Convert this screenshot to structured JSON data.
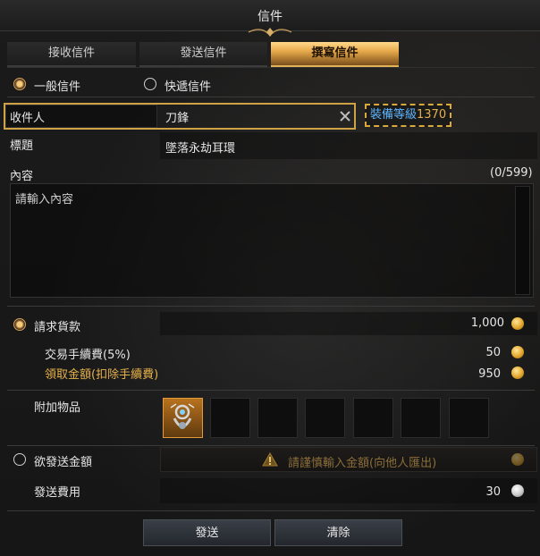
{
  "window": {
    "title": "信件"
  },
  "tabs": [
    {
      "label": "接收信件",
      "active": false
    },
    {
      "label": "發送信件",
      "active": false
    },
    {
      "label": "撰寫信件",
      "active": true
    }
  ],
  "mail_type": {
    "options": [
      {
        "label": "一般信件",
        "selected": true
      },
      {
        "label": "快遞信件",
        "selected": false
      }
    ]
  },
  "recipient": {
    "label": "收件人",
    "value": "刀鋒",
    "clear_icon": "close-icon",
    "gear_level_label": "裝備等級",
    "gear_level_value": "1370"
  },
  "subject": {
    "label": "標題",
    "value": "墜落永劫耳環"
  },
  "content": {
    "label": "內容",
    "counter": "(0/599)",
    "placeholder": "請輸入內容"
  },
  "payment_request": {
    "label": "請求貨款",
    "selected": true,
    "amount": "1,000",
    "fee_label": "交易手續費(5%)",
    "fee_value": "50",
    "receive_label": "領取金額(扣除手續費)",
    "receive_value": "950",
    "coin_icon": "gold-coin-icon"
  },
  "attachments": {
    "label": "附加物品",
    "slots": [
      {
        "item": "earring-item-icon"
      },
      {
        "item": ""
      },
      {
        "item": ""
      },
      {
        "item": ""
      },
      {
        "item": ""
      },
      {
        "item": ""
      },
      {
        "item": ""
      }
    ]
  },
  "send_gold": {
    "label": "欲發送金額",
    "selected": false,
    "warning": "請謹慎輸入金額(向他人匯出)",
    "warning_icon": "warning-icon"
  },
  "send_fee": {
    "label": "發送費用",
    "value": "30",
    "coin_icon": "silver-coin-icon"
  },
  "buttons": {
    "send": "發送",
    "clear": "清除"
  },
  "colors": {
    "accent_gold": "#e6b14a",
    "gear_blue": "#5fb6ff",
    "active_tab": "#e6a94a"
  }
}
